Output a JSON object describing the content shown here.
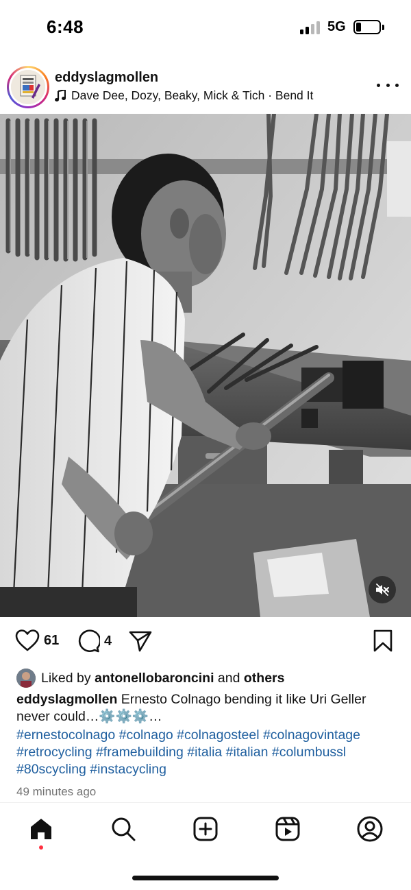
{
  "status_bar": {
    "time": "6:48",
    "network": "5G"
  },
  "post": {
    "username": "eddyslagmollen",
    "audio": "Dave Dee, Dozy, Beaky, Mick & Tich · Bend It",
    "likes": "61",
    "comments": "4",
    "liked_by_prefix": "Liked by",
    "liked_by_user": "antonellobaroncini",
    "liked_by_and": "and",
    "liked_by_others": "others",
    "caption_user": "eddyslagmollen",
    "caption_text": "Ernesto Colnago bending it like Uri Geller never could…⚙️⚙️⚙️…",
    "hashtags": "#ernestocolnago #colnago #colnagosteel #colnagovintage #retrocycling #framebuilding #italia #italian #columbussl #80scycling #instacycling",
    "timestamp": "49 minutes ago"
  },
  "icons": [
    "music-note-icon",
    "more-icon",
    "mute-icon",
    "heart-icon",
    "comment-icon",
    "share-icon",
    "bookmark-icon",
    "home-icon",
    "search-icon",
    "create-icon",
    "reels-icon",
    "profile-icon"
  ],
  "colors": {
    "hashtag": "#1f5f9f",
    "notification_dot": "#ff3040",
    "secondary_text": "#737373"
  }
}
